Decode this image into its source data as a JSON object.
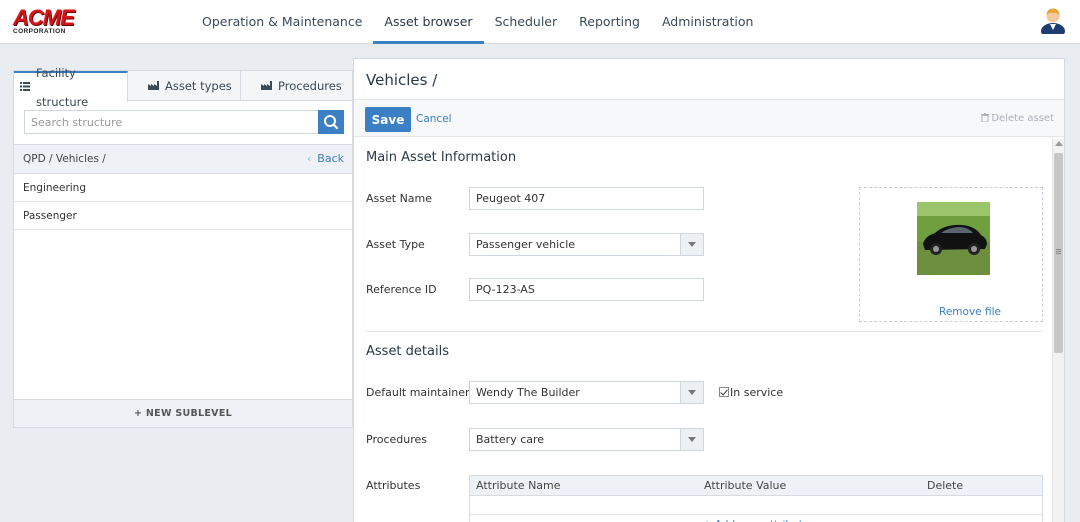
{
  "logo": {
    "main": "ACME",
    "sub": "CORPORATION"
  },
  "nav": {
    "items": [
      {
        "label": "Operation & Maintenance"
      },
      {
        "label": "Asset browser"
      },
      {
        "label": "Scheduler"
      },
      {
        "label": "Reporting"
      },
      {
        "label": "Administration"
      }
    ],
    "active": "Asset browser"
  },
  "left": {
    "tabs": [
      {
        "label": "Facility structure"
      },
      {
        "label": "Asset types"
      },
      {
        "label": "Procedures"
      }
    ],
    "search_placeholder": "Search structure",
    "breadcrumb": "QPD / Vehicles /",
    "back_label": "Back",
    "items": [
      {
        "label": "Engineering"
      },
      {
        "label": "Passenger"
      }
    ],
    "new_sublevel": "+ NEW SUBLEVEL"
  },
  "right": {
    "title": "Vehicles /",
    "save_label": "Save",
    "cancel_label": "Cancel",
    "delete_label": "Delete asset",
    "main_section": "Main Asset Information",
    "fields": {
      "asset_name_label": "Asset Name",
      "asset_name": "Peugeot 407",
      "asset_type_label": "Asset Type",
      "asset_type": "Passenger vehicle",
      "reference_id_label": "Reference ID",
      "reference_id": "PQ-123-AS"
    },
    "remove_file": "Remove file",
    "details_section": "Asset details",
    "details": {
      "maintainer_label": "Default maintainer",
      "maintainer": "Wendy The Builder",
      "in_service_label": "In service",
      "procedures_label": "Procedures",
      "procedures": "Battery care",
      "attributes_label": "Attributes"
    },
    "attributes_table": {
      "columns": [
        "Attribute Name",
        "Attribute Value",
        "Delete"
      ],
      "add_label": "+ Add new attribute"
    }
  },
  "colors": {
    "accent": "#3b7fc4",
    "brand_red": "#d8141b"
  }
}
